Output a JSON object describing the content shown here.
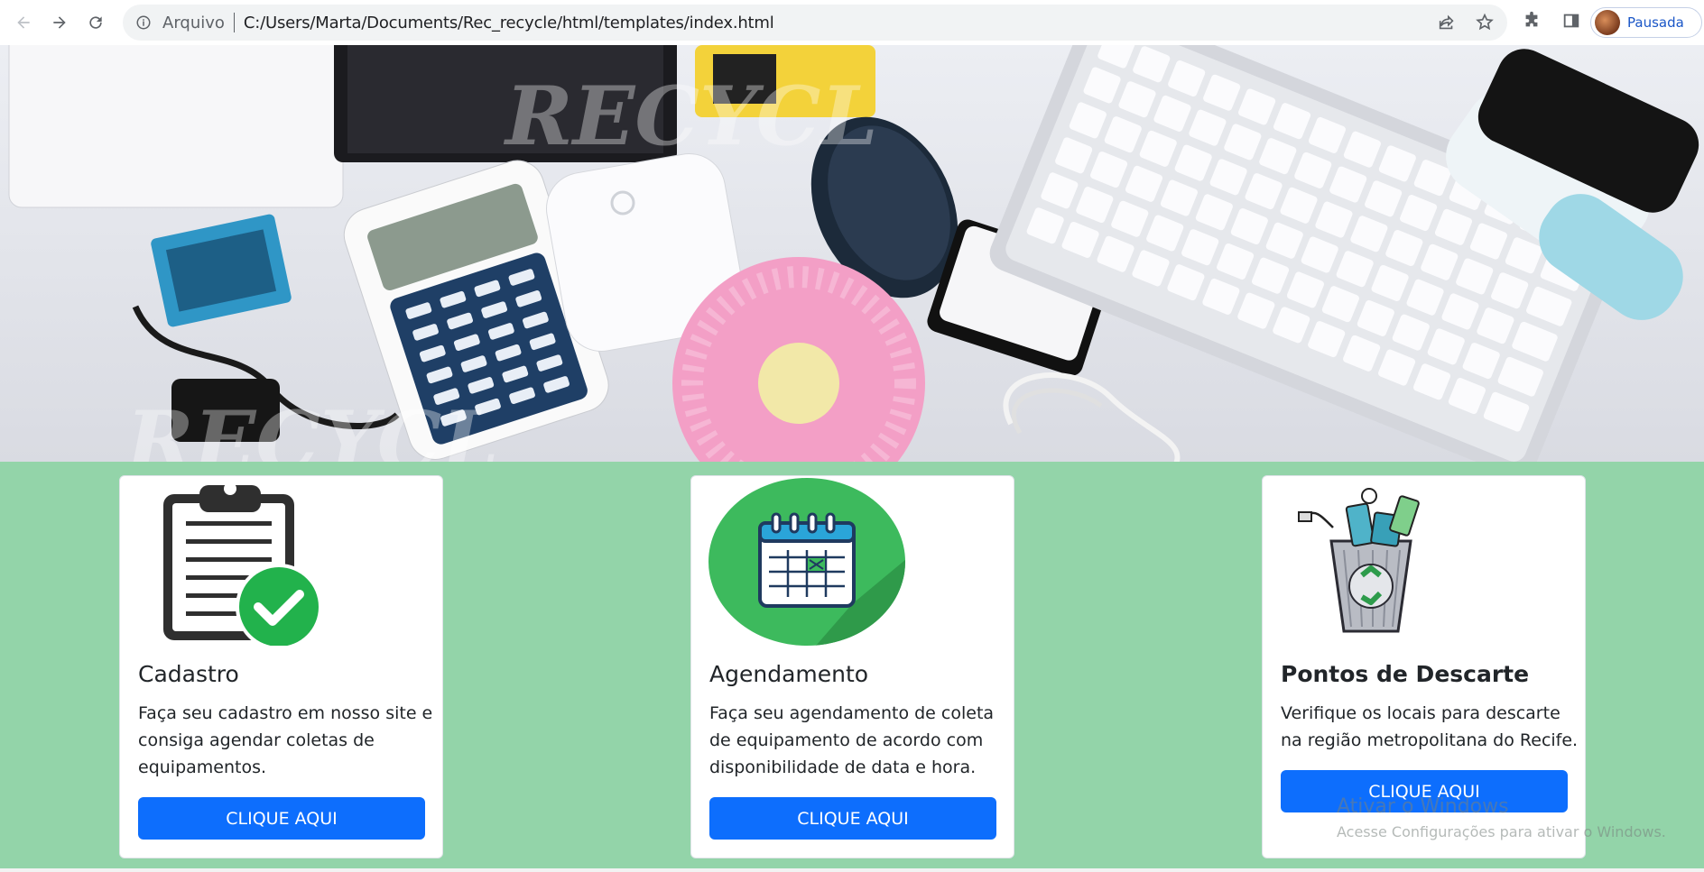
{
  "browser": {
    "scheme_label": "Arquivo",
    "url": "C:/Users/Marta/Documents/Rec_recycle/html/templates/index.html",
    "profile_label": "Pausada"
  },
  "hero": {
    "description_icon": "electronics-photo"
  },
  "cards": [
    {
      "title": "Cadastro",
      "text": "Faça seu cadastro em nosso site e consiga agendar coletas de equipamentos.",
      "button": "CLIQUE AQUI",
      "icon": "clipboard-check-icon"
    },
    {
      "title": "Agendamento",
      "text": "Faça seu agendamento de coleta de equipamento de acordo com disponibilidade de data e hora.",
      "button": "CLIQUE AQUI",
      "icon": "calendar-icon"
    },
    {
      "title": "Pontos de Descarte",
      "text": "Verifique os locais para descarte na região metropolitana do Recife.",
      "button": "CLIQUE AQUI",
      "icon": "recycle-bin-icon"
    }
  ],
  "watermark": {
    "line1": "Ativar o Windows",
    "line2": "Acesse Configurações para ativar o Windows."
  },
  "colors": {
    "green_bg": "#93d4a9",
    "button_blue": "#0d6efd",
    "circle_green": "#3dba5d"
  }
}
